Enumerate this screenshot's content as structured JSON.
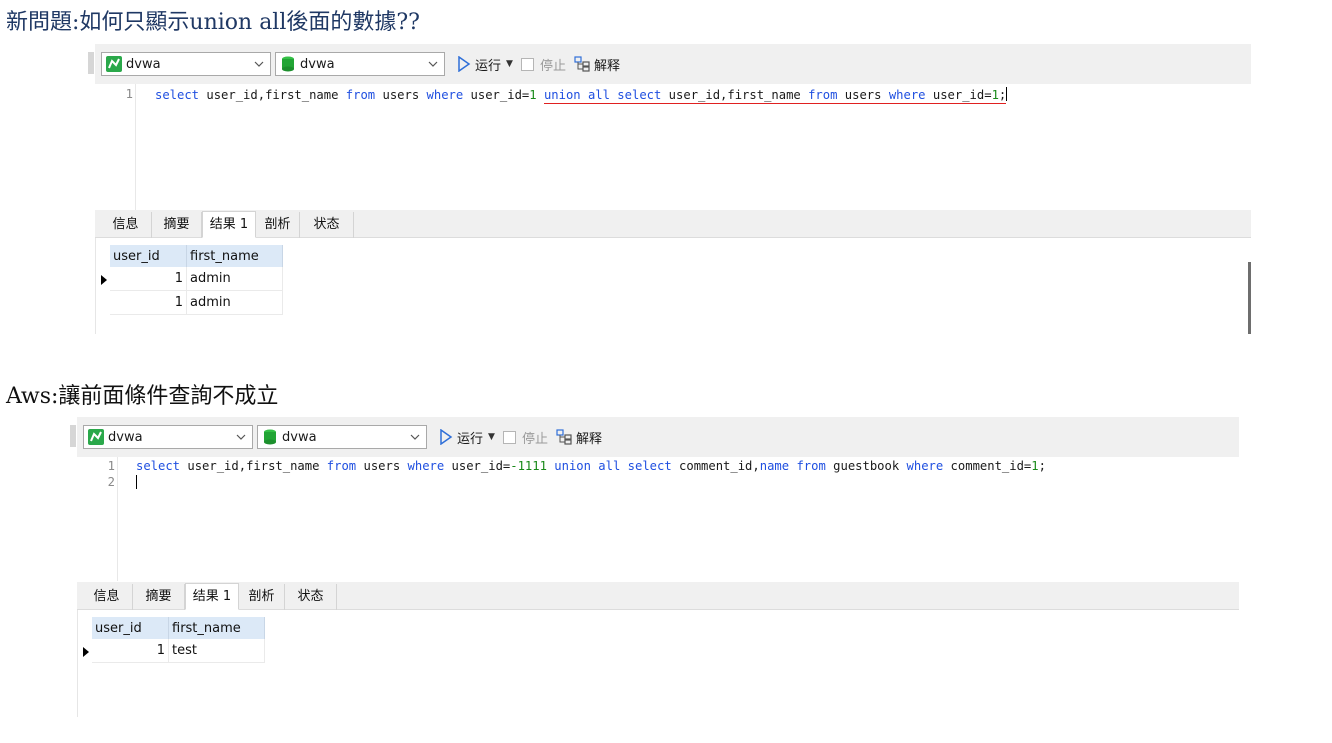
{
  "headings": {
    "question": "新問題:如何只顯示union all後面的數據??",
    "answer": "Aws:讓前面條件查詢不成立"
  },
  "toolbar": {
    "connection": "dvwa",
    "database": "dvwa",
    "run_label": "运行",
    "stop_label": "停止",
    "explain_label": "解释"
  },
  "tabs": [
    "信息",
    "摘要",
    "结果 1",
    "剖析",
    "状态"
  ],
  "panel1": {
    "line_numbers": [
      "1"
    ],
    "query_tokens": [
      "select",
      " user_id,first_name ",
      "from",
      " users ",
      "where",
      " user_id=",
      "1",
      " ",
      "union all select",
      " user_id,first_name ",
      "from",
      " users ",
      "where",
      " user_id=",
      "1",
      ";"
    ],
    "columns": [
      "user_id",
      "first_name"
    ],
    "rows": [
      {
        "user_id": "1",
        "first_name": "admin"
      },
      {
        "user_id": "1",
        "first_name": "admin"
      }
    ]
  },
  "panel2": {
    "line_numbers": [
      "1",
      "2"
    ],
    "query_tokens": [
      "select",
      " user_id,first_name ",
      "from",
      " users ",
      "where",
      " user_id=",
      "-1111",
      " ",
      "union all select",
      " comment_id,",
      "name",
      " ",
      "from",
      " guestbook ",
      "where",
      " comment_id=",
      "1",
      ";"
    ],
    "columns": [
      "user_id",
      "first_name"
    ],
    "rows": [
      {
        "user_id": "1",
        "first_name": "test"
      }
    ]
  },
  "colors": {
    "keyword": "#1f4fe0",
    "number": "#1a8a1a",
    "underline": "#e02020",
    "header_bg": "#dce9f7",
    "toolbar_bg": "#f0f0f0"
  }
}
